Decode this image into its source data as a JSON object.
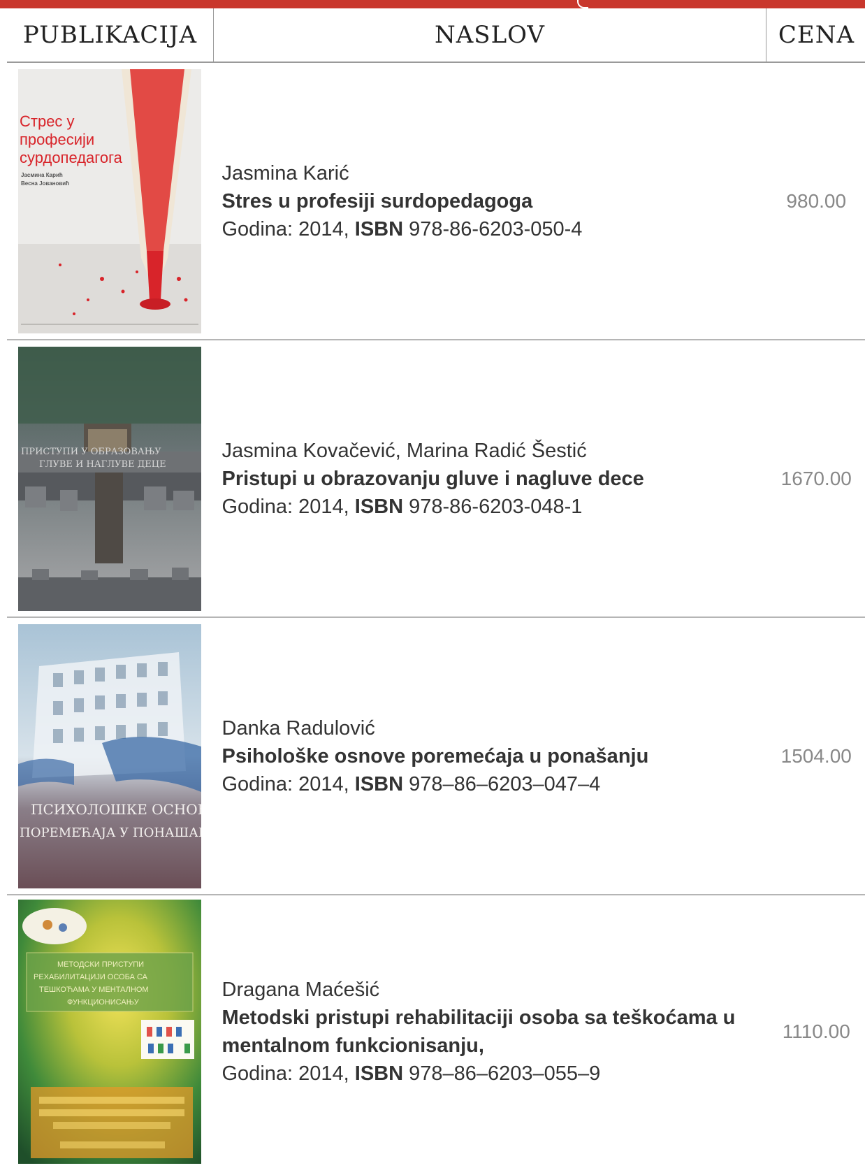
{
  "header": {
    "col_publication": "PUBLIKACIJA",
    "col_title": "NASLOV",
    "col_price": "CENA"
  },
  "books": [
    {
      "author": "Jasmina Karić",
      "title": "Stres u profesiji surdopedagoga",
      "year_prefix": "Godina: 2014,",
      "isbn_label": "ISBN",
      "isbn": "978-86-6203-050-4",
      "price": "980.00",
      "cover_text": [
        "Стрес у",
        "професији",
        "сурдопедагога",
        "Јасмина Карић",
        "Весна Јовановић"
      ]
    },
    {
      "author": "Jasmina Kovačević, Marina Radić Šestić",
      "title": "Pristupi u obrazovanju gluve i nagluve dece",
      "year_prefix": "Godina: 2014,",
      "isbn_label": "ISBN",
      "isbn": "978-86-6203-048-1",
      "price": "1670.00",
      "cover_text": [
        "ПРИСТУПИ У ОБРАЗОВАЊУ",
        "ГЛУВЕ И НАГЛУВЕ ДЕЦЕ"
      ]
    },
    {
      "author": "Danka Radulović",
      "title": "Psihološke osnove poremećaja u ponašanju",
      "year_prefix": "Godina: 2014,",
      "isbn_label": "ISBN",
      "isbn": "978–86–6203–047–4",
      "price": "1504.00",
      "cover_text": [
        "ПСИХОЛОШКЕ ОСНОВЕ",
        "ПОРЕМЕЋАЈА У ПОНАШАЊУ"
      ]
    },
    {
      "author": "Dragana Maćešić",
      "title": "Metodski pristupi rehabilitaciji osoba sa teškoćama u mentalnom funkcionisanju,",
      "year_prefix": "Godina: 2014,",
      "isbn_label": "ISBN",
      "isbn": "978–86–6203–055–9",
      "price": "1110.00",
      "cover_text": [
        "МЕТОДСКИ ПРИСТУПИ",
        "РЕХАБИЛИТАЦИЈИ ОСОБА СА",
        "ТЕШКОЋАМА У МЕНТАЛНОМ",
        "ФУНКЦИОНИСАЊУ"
      ]
    }
  ],
  "colors": {
    "accent": "#c9372c",
    "text": "#333333",
    "price": "#888888"
  }
}
